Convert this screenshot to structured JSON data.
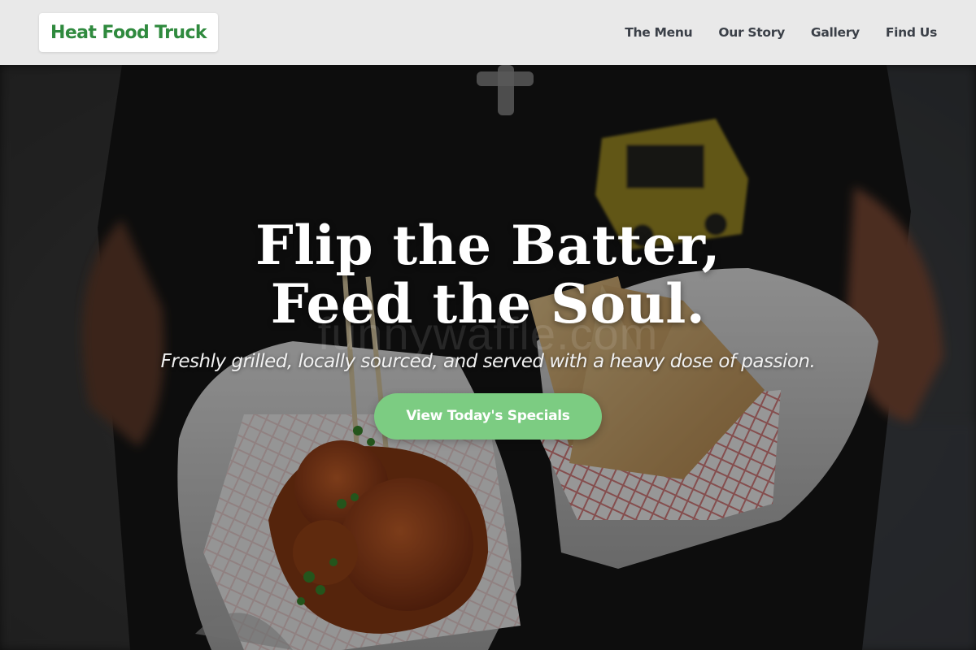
{
  "header": {
    "logo_text": "Heat Food Truck",
    "nav": [
      {
        "label": "The Menu"
      },
      {
        "label": "Our Story"
      },
      {
        "label": "Gallery"
      },
      {
        "label": "Find Us"
      }
    ]
  },
  "hero": {
    "title_line1": "Flip the Batter,",
    "title_line2": "Feed the Soul.",
    "subtitle": "Freshly grilled, locally sourced, and served with a heavy dose of passion.",
    "cta_label": "View Today's Specials",
    "watermark": "funnywaffle.com"
  },
  "colors": {
    "brand_green": "#2f8a3e",
    "cta_green": "#7ccc82",
    "header_bg": "#e9e9e9",
    "nav_text": "#3b4048"
  }
}
